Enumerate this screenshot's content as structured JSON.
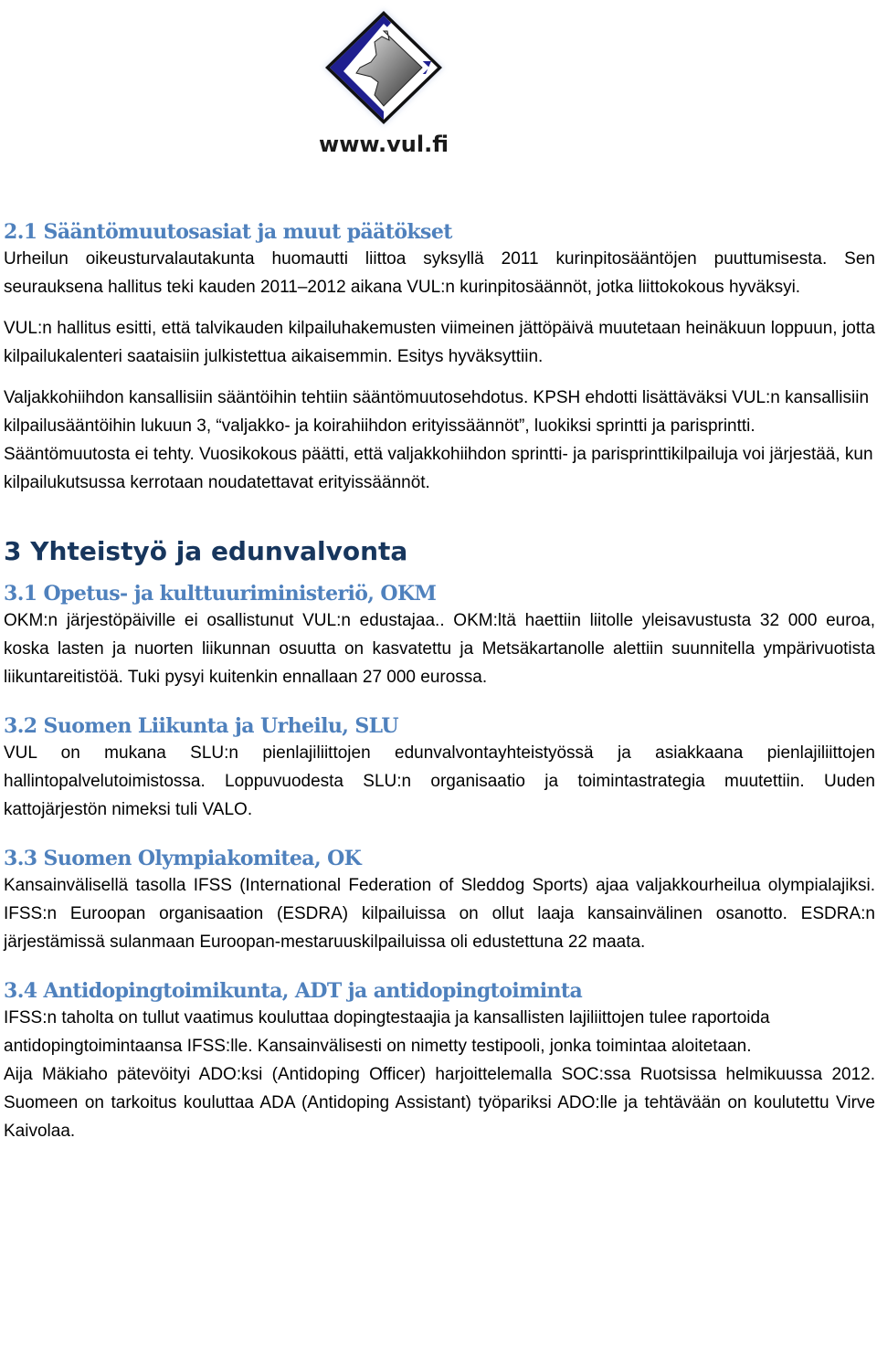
{
  "logo": {
    "icon": "vul-diamond-logo-icon",
    "text": "www.vul.fi",
    "colors": {
      "blue": "#1f1f8f",
      "frame": "#111111",
      "gray": "#888888"
    }
  },
  "section_2_1": {
    "heading": "2.1 Sääntömuutosasiat ja muut päätökset",
    "paragraphs": [
      "Urheilun oikeusturvalautakunta huomautti liittoa syksyllä 2011 kurinpitosääntöjen puuttumisesta. Sen seurauksena hallitus teki kauden 2011–2012 aikana VUL:n kurinpitosäännöt, jotka liittokokous hyväksyi.",
      "VUL:n hallitus esitti, että talvikauden kilpailuhakemusten viimeinen jättöpäivä muutetaan heinäkuun loppuun, jotta kilpailukalenteri saataisiin julkistettua aikaisemmin. Esitys hyväksyttiin.",
      "Valjakkohiihdon kansallisiin sääntöihin tehtiin sääntömuutosehdotus. KPSH ehdotti lisättäväksi VUL:n kansallisiin kilpailusääntöihin lukuun 3, “valjakko- ja koirahiihdon erityissäännöt”, luokiksi sprintti ja parisprintti. Sääntömuutosta ei tehty. Vuosikokous päätti, että valjakkohiihdon sprintti- ja parisprinttikilpailuja voi järjestää, kun kilpailukutsussa kerrotaan noudatettavat erityissäännöt."
    ]
  },
  "section_3": {
    "heading": "3 Yhteistyö ja edunvalvonta",
    "subsections": [
      {
        "heading": "3.1 Opetus- ja kulttuuriministeriö, OKM",
        "paragraphs": [
          "OKM:n järjestöpäiville ei osallistunut VUL:n edustajaa.. OKM:ltä haettiin liitolle yleisavustusta 32 000 euroa, koska lasten ja nuorten liikunnan osuutta on kasvatettu ja Metsäkartanolle alettiin suunnitella ympärivuotista liikuntareitistöä. Tuki pysyi kuitenkin ennallaan 27 000 eurossa."
        ]
      },
      {
        "heading": "3.2 Suomen Liikunta ja Urheilu, SLU",
        "paragraphs": [
          "VUL on mukana SLU:n pienlajiliittojen edunvalvontayhteistyössä ja asiakkaana pienlajiliittojen hallintopalvelutoimistossa. Loppuvuodesta SLU:n organisaatio ja toimintastrategia muutettiin. Uuden kattojärjestön nimeksi tuli VALO."
        ]
      },
      {
        "heading": "3.3 Suomen Olympiakomitea, OK",
        "paragraphs": [
          "Kansainvälisellä tasolla IFSS (International Federation of Sleddog Sports) ajaa valjakkourheilua olympialajiksi. IFSS:n Euroopan organisaation (ESDRA) kilpailuissa on ollut laaja kansainvälinen osanotto. ESDRA:n järjestämissä sulanmaan Euroopan-mestaruuskilpailuissa oli edustettuna 22 maata."
        ]
      },
      {
        "heading": "3.4 Antidopingtoimikunta, ADT ja antidopingtoiminta",
        "paragraphs": [
          "IFSS:n taholta on tullut vaatimus kouluttaa dopingtestaajia ja kansallisten lajiliittojen tulee raportoida antidopingtoimintaansa IFSS:lle. Kansainvälisesti on nimetty testipooli, jonka toimintaa aloitetaan.",
          "Aija Mäkiaho pätevöityi ADO:ksi (Antidoping Officer) harjoittelemalla SOC:ssa Ruotsissa helmikuussa 2012. Suomeen on tarkoitus kouluttaa ADA (Antidoping Assistant) työpariksi ADO:lle ja tehtävään on koulutettu Virve Kaivolaa."
        ]
      }
    ]
  }
}
